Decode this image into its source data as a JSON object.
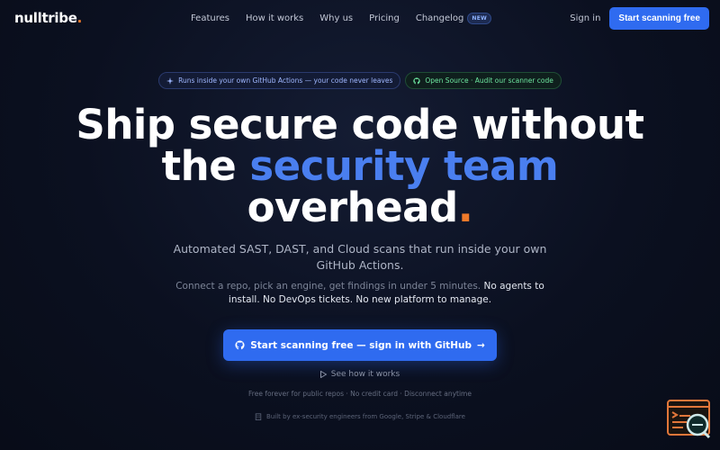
{
  "nav": {
    "logo_main": "nulltribe",
    "logo_dot": ".",
    "links": [
      "Features",
      "How it works",
      "Why us",
      "Pricing",
      "Changelog"
    ],
    "changelog_badge": "NEW",
    "signin": "Sign in",
    "cta": "Start scanning free"
  },
  "pills": {
    "left": "Runs inside your own GitHub Actions — your code never leaves",
    "right": "Open Source · Audit our scanner code"
  },
  "headline": {
    "line1": "Ship secure code without",
    "line2_plain": "the ",
    "line2_accent": "security team",
    "line3": "overhead",
    "line3_dot": "."
  },
  "subhead": "Automated SAST, DAST, and Cloud scans that run inside your own GitHub Actions.",
  "desc": {
    "muted": "Connect a repo, pick an engine, get findings in under 5 minutes. ",
    "bright": "No agents to install. No DevOps tickets. No new platform to manage."
  },
  "cta": {
    "label": "Start scanning free — sign in with GitHub",
    "arrow": "→"
  },
  "see_how": "See how it works",
  "fineprint": "Free forever for public repos · No credit card · Disconnect anytime",
  "builtby": "Built by ex-security engineers from Google, Stripe & Cloudflare",
  "colors": {
    "accent": "#2f6bf0",
    "brand_orange": "#f07a2a",
    "background": "#0b1020"
  },
  "icons": {
    "pill_left": "sparkle-icon",
    "pill_right": "github-icon",
    "cta": "github-icon",
    "see_how": "play-icon",
    "builtby": "building-icon",
    "widget": "scanner-terminal-icon"
  }
}
